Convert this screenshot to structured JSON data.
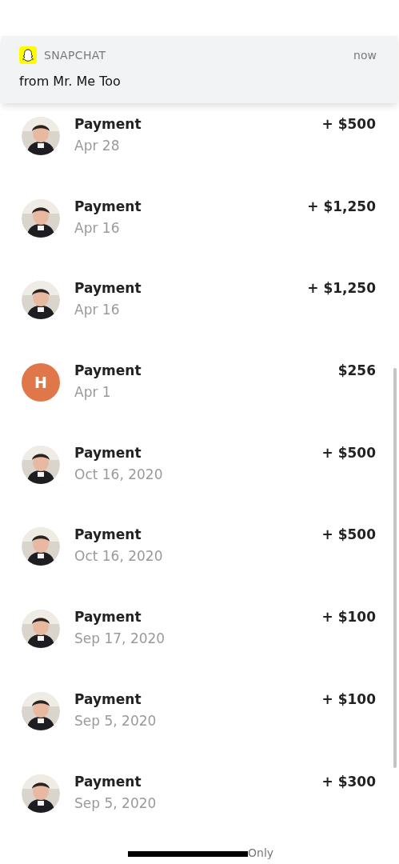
{
  "notification": {
    "app": "SNAPCHAT",
    "time": "now",
    "message": "from Mr. Me Too"
  },
  "transactions": [
    {
      "title": "Payment",
      "date": "Apr 28",
      "amount": "+ $500"
    },
    {
      "title": "Payment",
      "date": "Apr 16",
      "amount": "+ $1,250"
    },
    {
      "title": "Payment",
      "date": "Apr 16",
      "amount": "+ $1,250"
    },
    {
      "avatar": {
        "kind": "initial",
        "letter": "H",
        "color": "#e0774a"
      },
      "title": "Payment",
      "date": "Apr 1",
      "amount": "$256"
    },
    {
      "title": "Payment",
      "date": "Oct 16, 2020",
      "amount": "+ $500"
    },
    {
      "title": "Payment",
      "date": "Oct 16, 2020",
      "amount": "+ $500"
    },
    {
      "title": "Payment",
      "date": "Sep 17, 2020",
      "amount": "+ $100"
    },
    {
      "title": "Payment",
      "date": "Sep 5, 2020",
      "amount": "+ $100"
    },
    {
      "title": "Payment",
      "date": "Sep 5, 2020",
      "amount": "+ $300"
    }
  ],
  "footer": {
    "caption": "Only"
  }
}
